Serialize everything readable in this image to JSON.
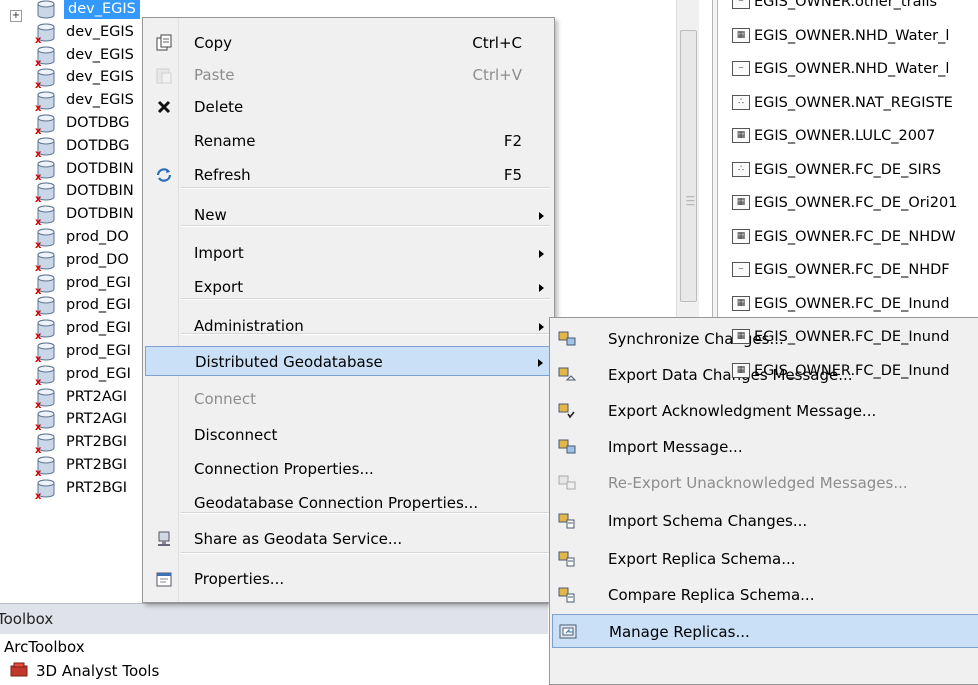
{
  "tree": {
    "items": [
      {
        "label": "dev_EGIS",
        "selected": true
      },
      {
        "label": "dev_EGIS"
      },
      {
        "label": "dev_EGIS"
      },
      {
        "label": "dev_EGIS"
      },
      {
        "label": "dev_EGIS"
      },
      {
        "label": "DOTDBG"
      },
      {
        "label": "DOTDBG"
      },
      {
        "label": "DOTDBIN"
      },
      {
        "label": "DOTDBIN"
      },
      {
        "label": "DOTDBIN"
      },
      {
        "label": "prod_DO"
      },
      {
        "label": "prod_DO"
      },
      {
        "label": "prod_EGI"
      },
      {
        "label": "prod_EGI"
      },
      {
        "label": "prod_EGI"
      },
      {
        "label": "prod_EGI"
      },
      {
        "label": "prod_EGI"
      },
      {
        "label": "PRT2AGI"
      },
      {
        "label": "PRT2AGI"
      },
      {
        "label": "PRT2BGI"
      },
      {
        "label": "PRT2BGI"
      },
      {
        "label": "PRT2BGI"
      }
    ],
    "expander": "+"
  },
  "toolbox": {
    "header": "Toolbox",
    "root": "ArcToolbox",
    "first_tool": "3D Analyst Tools"
  },
  "right_panel": {
    "items": [
      {
        "label": "EGIS_OWNER.other_trails",
        "icon": "line"
      },
      {
        "label": "EGIS_OWNER.NHD_Water_l",
        "icon": "raster"
      },
      {
        "label": "EGIS_OWNER.NHD_Water_l",
        "icon": "line"
      },
      {
        "label": "EGIS_OWNER.NAT_REGISTE",
        "icon": "point"
      },
      {
        "label": "EGIS_OWNER.LULC_2007",
        "icon": "raster"
      },
      {
        "label": "EGIS_OWNER.FC_DE_SIRS",
        "icon": "point"
      },
      {
        "label": "EGIS_OWNER.FC_DE_Ori201",
        "icon": "raster"
      },
      {
        "label": "EGIS_OWNER.FC_DE_NHDW",
        "icon": "raster"
      },
      {
        "label": "EGIS_OWNER.FC_DE_NHDF",
        "icon": "line"
      },
      {
        "label": "EGIS_OWNER.FC_DE_Inund",
        "icon": "raster"
      },
      {
        "label": "EGIS_OWNER.FC_DE_Inund",
        "icon": "raster"
      },
      {
        "label": "EGIS_OWNER.FC_DE_Inund",
        "icon": "raster"
      }
    ]
  },
  "context_menu": {
    "items": [
      {
        "label": "Copy",
        "shortcut": "Ctrl+C",
        "icon": "copy-icon"
      },
      {
        "label": "Paste",
        "shortcut": "Ctrl+V",
        "icon": "paste-icon",
        "disabled": true
      },
      {
        "label": "Delete",
        "icon": "delete-icon"
      },
      {
        "label": "Rename",
        "shortcut": "F2"
      },
      {
        "label": "Refresh",
        "shortcut": "F5",
        "icon": "refresh-icon"
      },
      {
        "label": "New",
        "submenu": true
      },
      {
        "label": "Import",
        "submenu": true
      },
      {
        "label": "Export",
        "submenu": true
      },
      {
        "label": "Administration",
        "submenu": true
      },
      {
        "label": "Distributed Geodatabase",
        "submenu": true,
        "highlighted": true
      },
      {
        "label": "Connect",
        "disabled": true
      },
      {
        "label": "Disconnect"
      },
      {
        "label": "Connection Properties..."
      },
      {
        "label": "Geodatabase Connection Properties..."
      },
      {
        "label": "Share as Geodata Service...",
        "icon": "share-service-icon"
      },
      {
        "label": "Properties...",
        "icon": "properties-icon"
      }
    ]
  },
  "submenu": {
    "items": [
      {
        "label": "Synchronize Changes...",
        "icon": "synchronize-icon"
      },
      {
        "label": "Export Data Changes Message...",
        "icon": "export-data-changes-icon"
      },
      {
        "label": "Export Acknowledgment Message...",
        "icon": "export-acknowledgment-icon"
      },
      {
        "label": "Import Message...",
        "icon": "import-message-icon"
      },
      {
        "label": "Re-Export Unacknowledged Messages...",
        "icon": "reexport-icon",
        "disabled": true
      },
      {
        "label": "Import Schema Changes...",
        "icon": "import-schema-icon"
      },
      {
        "label": "Export Replica Schema...",
        "icon": "export-schema-icon"
      },
      {
        "label": "Compare Replica Schema...",
        "icon": "compare-schema-icon"
      },
      {
        "label": "Manage Replicas...",
        "icon": "manage-replicas-icon",
        "highlighted": true
      }
    ]
  },
  "colors": {
    "selection": "#3399ff",
    "menu_highlight": "#c9e0f7",
    "menu_highlight_border": "#7da2ce",
    "menu_bg": "#f0f0f0",
    "disabled_text": "#8d8d8d"
  }
}
